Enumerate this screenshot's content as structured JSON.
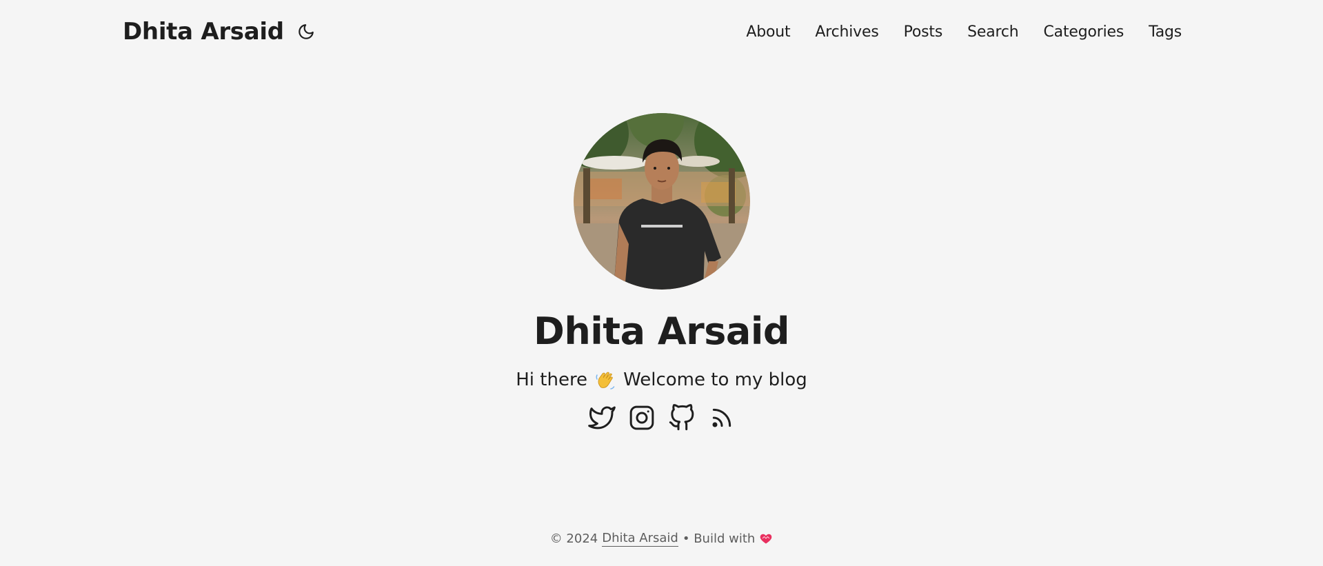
{
  "header": {
    "logo": "Dhita Arsaid",
    "theme_icon": "moon-icon",
    "nav": [
      {
        "label": "About"
      },
      {
        "label": "Archives"
      },
      {
        "label": "Posts"
      },
      {
        "label": "Search"
      },
      {
        "label": "Categories"
      },
      {
        "label": "Tags"
      }
    ]
  },
  "profile": {
    "name": "Dhita Arsaid",
    "subtitle_before": "Hi there",
    "subtitle_emoji": "wave-emoji",
    "subtitle_after": "Welcome to my blog",
    "social": [
      {
        "icon": "twitter-icon"
      },
      {
        "icon": "instagram-icon"
      },
      {
        "icon": "github-icon"
      },
      {
        "icon": "rss-icon"
      }
    ]
  },
  "footer": {
    "copyright": "© 2024",
    "author_link": "Dhita Arsaid",
    "build_text": "• Build with",
    "heart_icon": "heart-icon"
  },
  "colors": {
    "background": "#f5f5f5",
    "text": "#1e1e1e",
    "muted": "#5d5d5d",
    "heart": "#e8305f"
  }
}
